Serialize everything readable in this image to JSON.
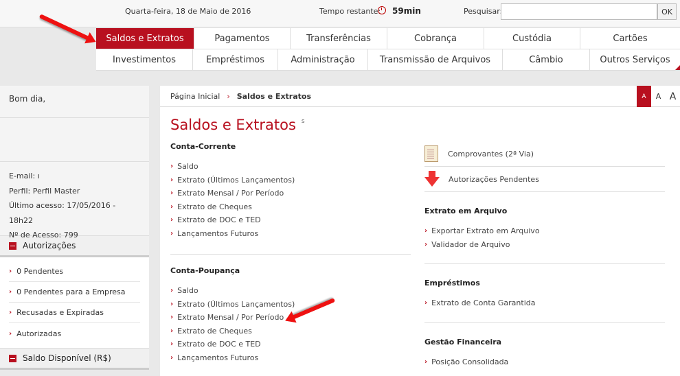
{
  "topbar": {
    "date": "Quarta-feira, 18 de Maio de 2016",
    "timer_label": "Tempo restante:",
    "timer_value": "59min",
    "search_label": "Pesquisar:",
    "search_value": "",
    "ok_label": "OK"
  },
  "nav": {
    "row1": [
      "Saldos e Extratos",
      "Pagamentos",
      "Transferências",
      "Cobrança",
      "Custódia",
      "Cartões"
    ],
    "row2": [
      "Investimentos",
      "Empréstimos",
      "Administração",
      "Transmissão de Arquivos",
      "Câmbio",
      "Outros Serviços"
    ],
    "active": "Saldos e Extratos",
    "accent_color": "#b8101f"
  },
  "sidebar": {
    "greeting": "Bom dia,",
    "email": "E-mail: ı",
    "profile": "Perfil: Perfil Master",
    "last_access": "Último acesso: 17/05/2016 - 18h22",
    "access_count": "Nº de Acesso: 799",
    "authorizations": {
      "title": "Autorizações",
      "items": [
        "0 Pendentes",
        "0 Pendentes para a Empresa",
        "Recusadas e Expiradas",
        "Autorizadas"
      ]
    },
    "balance_title": "Saldo Disponível (R$)"
  },
  "main": {
    "breadcrumb": {
      "home": "Página Inicial",
      "current": "Saldos e Extratos"
    },
    "font_size_controls": [
      "A",
      "A",
      "A"
    ],
    "title": "Saldos e Extratos",
    "title_mark": "s",
    "conta_corrente": {
      "title": "Conta-Corrente",
      "links": [
        "Saldo",
        "Extrato (Últimos Lançamentos)",
        "Extrato Mensal / Por Período",
        "Extrato de Cheques",
        "Extrato de DOC e TED",
        "Lançamentos Futuros"
      ]
    },
    "conta_poupanca": {
      "title": "Conta-Poupança",
      "links": [
        "Saldo",
        "Extrato (Últimos Lançamentos)",
        "Extrato Mensal / Por Período",
        "Extrato de Cheques",
        "Extrato de DOC e TED",
        "Lançamentos Futuros"
      ]
    },
    "quick": {
      "comprovantes": "Comprovantes (2ª Via)",
      "autorizacoes": "Autorizações Pendentes"
    },
    "extrato_arquivo": {
      "title": "Extrato em Arquivo",
      "links": [
        "Exportar Extrato em Arquivo",
        "Validador de Arquivo"
      ]
    },
    "emprestimos": {
      "title": "Empréstimos",
      "links": [
        "Extrato de Conta Garantida"
      ]
    },
    "gestao": {
      "title": "Gestão Financeira",
      "links": [
        "Posição Consolidada"
      ]
    }
  }
}
